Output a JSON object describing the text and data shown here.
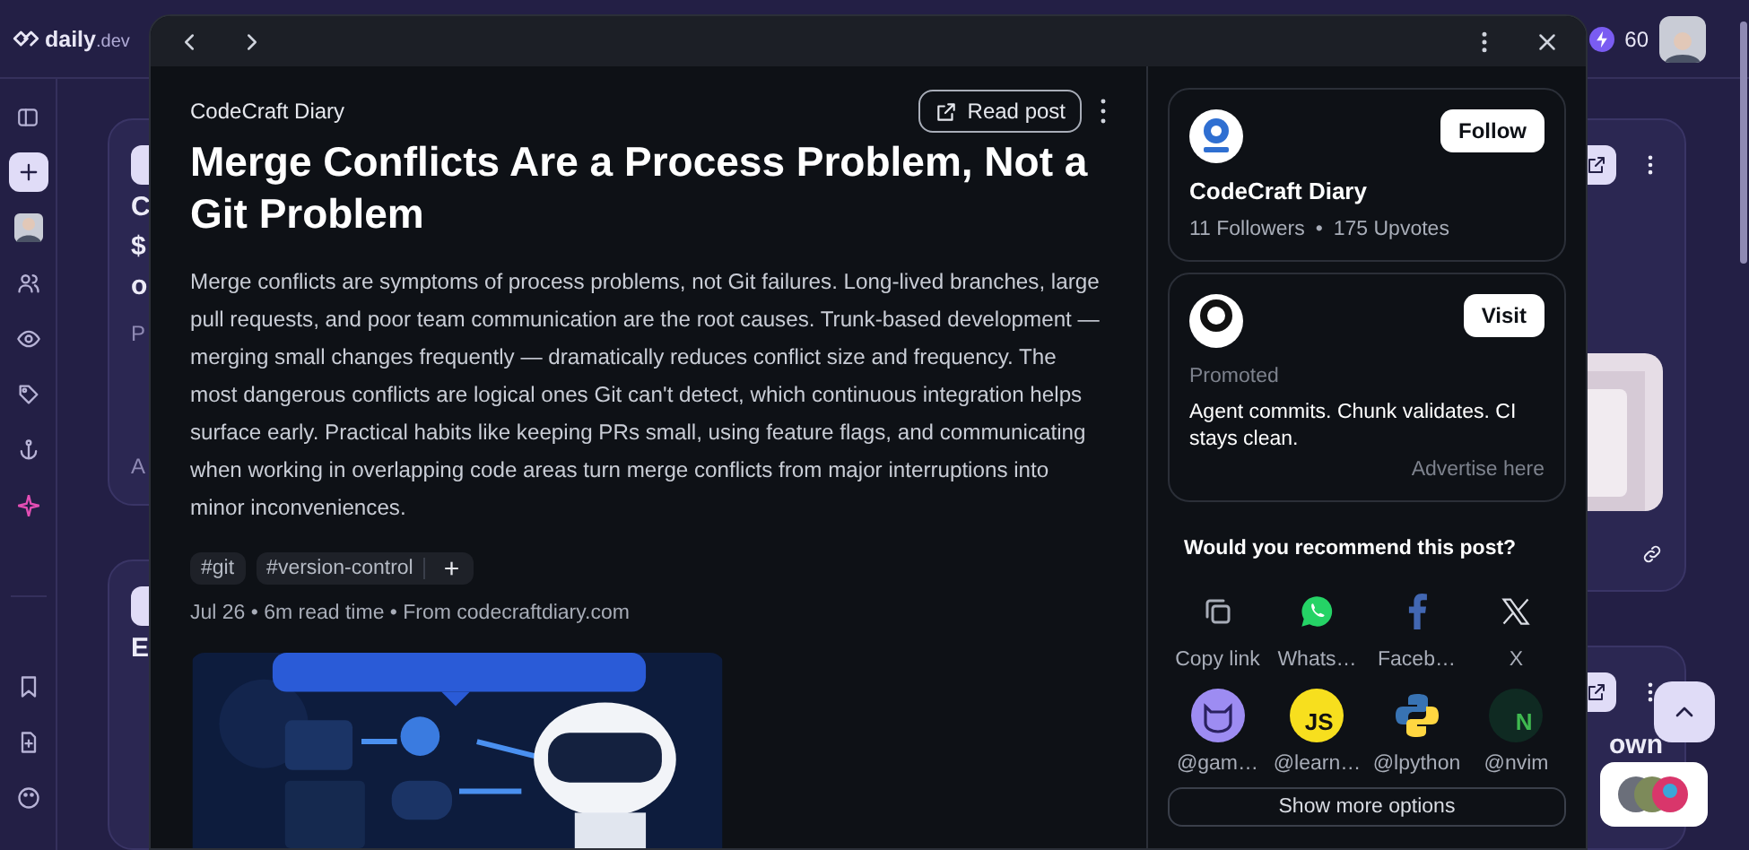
{
  "app": {
    "logo": "daily",
    "logo_suffix": ".dev",
    "reputation": "60"
  },
  "background_cards": [
    {
      "title_fragment": [
        "C",
        "$",
        "o"
      ],
      "source_fragment": "P",
      "footer_fragment": "A"
    },
    {
      "title_fragment": [
        "E"
      ]
    }
  ],
  "right_card_text": "own",
  "modal": {
    "source": "CodeCraft Diary",
    "read_post": "Read post",
    "title": "Merge Conflicts Are a Process Problem, Not a Git Problem",
    "summary": "Merge conflicts are symptoms of process problems, not Git failures. Long-lived branches, large pull requests, and poor team communication are the root causes. Trunk-based development — merging small changes frequently — dramatically reduces conflict size and frequency. The most dangerous conflicts are logical ones Git can't detect, which continuous integration helps surface early. Practical habits like keeping PRs small, using feature flags, and communicating when working in overlapping code areas turn merge conflicts from major interruptions into minor inconveniences.",
    "tags": [
      "#git",
      "#version-control"
    ],
    "add_tag": "+",
    "meta": "Jul 26 • 6m read time • From codecraftdiary.com"
  },
  "source_card": {
    "name": "CodeCraft Diary",
    "followers": "11 Followers",
    "separator": "•",
    "upvotes": "175 Upvotes",
    "follow": "Follow"
  },
  "ad": {
    "promoted": "Promoted",
    "text": "Agent commits. Chunk validates. CI stays clean.",
    "visit": "Visit",
    "advertise": "Advertise here"
  },
  "share": {
    "heading": "Would you recommend this post?",
    "options": [
      {
        "kind": "copy",
        "label": "Copy link"
      },
      {
        "kind": "whatsapp",
        "label": "Whats…"
      },
      {
        "kind": "facebook",
        "label": "Faceb…"
      },
      {
        "kind": "x",
        "label": "X"
      }
    ],
    "squads": [
      {
        "kind": "cat",
        "label": "@gam…"
      },
      {
        "kind": "js",
        "mark": "JS",
        "label": "@learn…"
      },
      {
        "kind": "python",
        "label": "@lpython"
      },
      {
        "kind": "nvim",
        "mark": "N",
        "label": "@nvim"
      }
    ],
    "more": "Show more options"
  }
}
